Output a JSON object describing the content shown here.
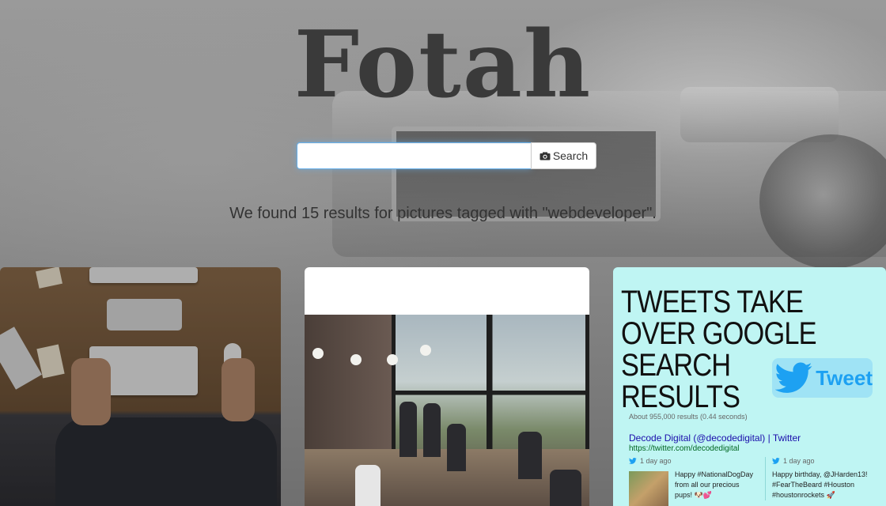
{
  "app": {
    "logo": "Fotah"
  },
  "search": {
    "value": "",
    "placeholder": "",
    "button_label": "Search",
    "button_icon": "camera-icon"
  },
  "results": {
    "message": "We found 15 results for pictures tagged with \"webdeveloper\"."
  },
  "cards": [
    {
      "kind": "photo",
      "subject": "desk-keyboard-top-view"
    },
    {
      "kind": "photo",
      "subject": "office-people-window"
    },
    {
      "kind": "graphic",
      "headline": "TWEETS TAKE OVER GOOGLE SEARCH RESULTS",
      "badge": "Tweet",
      "google": {
        "stats": "About 955,000 results (0.44 seconds)",
        "title": "Decode Digital (@decodedigital) | Twitter",
        "url": "https://twitter.com/decodedigital"
      },
      "tweets": [
        {
          "age": "1 day ago",
          "text": "Happy #NationalDogDay from all our precious pups! 🐶💕"
        },
        {
          "age": "1 day ago",
          "text": "Happy birthday, @JHarden13! #FearTheBeard #Houston #houstonrockets 🚀"
        }
      ]
    }
  ],
  "colors": {
    "input_focus": "#66afe9",
    "card3_bg": "#bff5f3",
    "twitter_blue": "#1da1f2",
    "text": "#333333"
  }
}
